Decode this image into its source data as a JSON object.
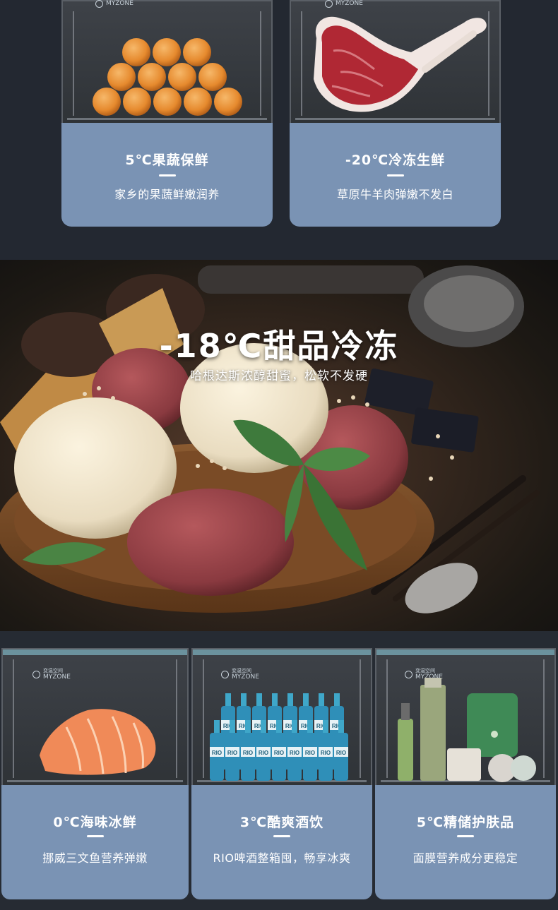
{
  "top_cards": [
    {
      "title": "5℃果蔬保鲜",
      "subtitle": "家乡的果蔬鲜嫩润养",
      "logo_text": "MYZONE",
      "item": "oranges"
    },
    {
      "title": "-20℃冷冻生鲜",
      "subtitle": "草原牛羊肉弹嫩不发白",
      "logo_text": "MYZONE",
      "item": "tomahawk-steak"
    }
  ],
  "hero": {
    "title": "-18℃甜品冷冻",
    "subtitle": "哈根达斯浓醇甜蜜，松软不发硬"
  },
  "bottom_cards": [
    {
      "title": "0℃海味冰鲜",
      "subtitle": "挪威三文鱼营养弹嫩",
      "logo_cn": "变温空间",
      "logo_text": "MYZONE",
      "item": "salmon"
    },
    {
      "title": "3℃酷爽酒饮",
      "subtitle": "RIO啤酒整箱囤，畅享冰爽",
      "logo_cn": "变温空间",
      "logo_text": "MYZONE",
      "item": "rio-bottles",
      "bottle_label": "RIO"
    },
    {
      "title": "5℃精储护肤品",
      "subtitle": "面膜营养成分更稳定",
      "logo_cn": "变温空间",
      "logo_text": "MYZONE",
      "item": "skincare"
    }
  ],
  "colors": {
    "panel": "#7a93b4",
    "page_bg": "#232831"
  }
}
